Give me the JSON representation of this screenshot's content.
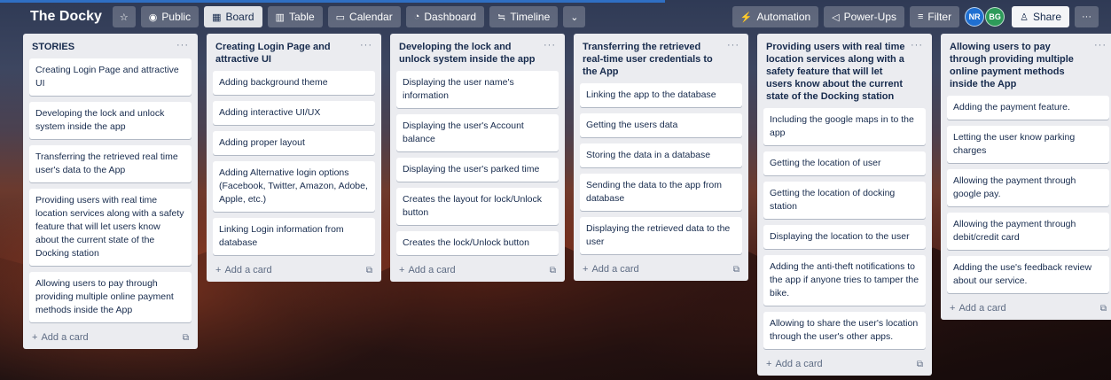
{
  "board": {
    "title": "The Docky",
    "star_icon": "☆",
    "visibility": {
      "icon": "◉",
      "label": "Public"
    },
    "views": [
      {
        "icon": "▦",
        "label": "Board"
      },
      {
        "icon": "▥",
        "label": "Table"
      },
      {
        "icon": "▭",
        "label": "Calendar"
      },
      {
        "icon": "◔",
        "label": "Dashboard"
      },
      {
        "icon": "≒",
        "label": "Timeline"
      }
    ],
    "more_views_icon": "⌄",
    "automation": {
      "icon": "⚡",
      "label": "Automation"
    },
    "powerups": {
      "icon": "◁",
      "label": "Power-Ups"
    },
    "filter": {
      "icon": "≡",
      "label": "Filter"
    },
    "members": [
      {
        "initials": "NR",
        "color": "#1f6fd1"
      },
      {
        "initials": "BG",
        "color": "#2e9b5a"
      }
    ],
    "share": {
      "icon": "♙",
      "label": "Share"
    },
    "more_icon": "···"
  },
  "lists": [
    {
      "title": "STORIES",
      "cards": [
        "Creating Login Page and attractive UI",
        "Developing the lock and unlock system inside the app",
        "Transferring the retrieved real time user's data to the App",
        "Providing users with real time location services along with a safety feature that will let users know about the current state of the Docking station",
        "Allowing users to pay through providing multiple online payment methods inside the App"
      ]
    },
    {
      "title": "Creating Login Page and attractive UI",
      "cards": [
        "Adding background theme",
        "Adding interactive UI/UX",
        "Adding proper layout",
        "Adding Alternative login options (Facebook, Twitter, Amazon, Adobe, Apple, etc.)",
        "Linking Login information from database"
      ]
    },
    {
      "title": "Developing the lock and unlock system inside the app",
      "cards": [
        "Displaying the user name's information",
        "Displaying the user's Account balance",
        "Displaying the user's parked time",
        "Creates the layout for lock/Unlock button",
        "Creates the lock/Unlock button"
      ]
    },
    {
      "title": "Transferring the retrieved real-time user credentials to the App",
      "cards": [
        "Linking the app to the database",
        "Getting the users data",
        "Storing the data in a database",
        "Sending the data to the app from database",
        "Displaying the retrieved data to the user"
      ]
    },
    {
      "title": "Providing users with real time location services along with a safety feature that will let users know about the current state of the Docking station",
      "cards": [
        "Including the google maps in to the app",
        "Getting the location of user",
        "Getting the location of docking station",
        "Displaying the location to the user",
        "Adding the anti-theft notifications to the app if anyone tries to tamper the bike.",
        "Allowing to share the user's location through the user's other apps."
      ]
    },
    {
      "title": "Allowing users to pay through providing multiple online payment methods inside the App",
      "cards": [
        "Adding the payment feature.",
        "Letting the user know parking charges",
        "Allowing the payment through google pay.",
        "Allowing the payment through debit/credit card",
        "Adding the use's feedback review about our service."
      ]
    }
  ],
  "list_menu_icon": "···",
  "add_card_icon": "+",
  "add_card_label": "Add a card",
  "template_icon": "⧉"
}
